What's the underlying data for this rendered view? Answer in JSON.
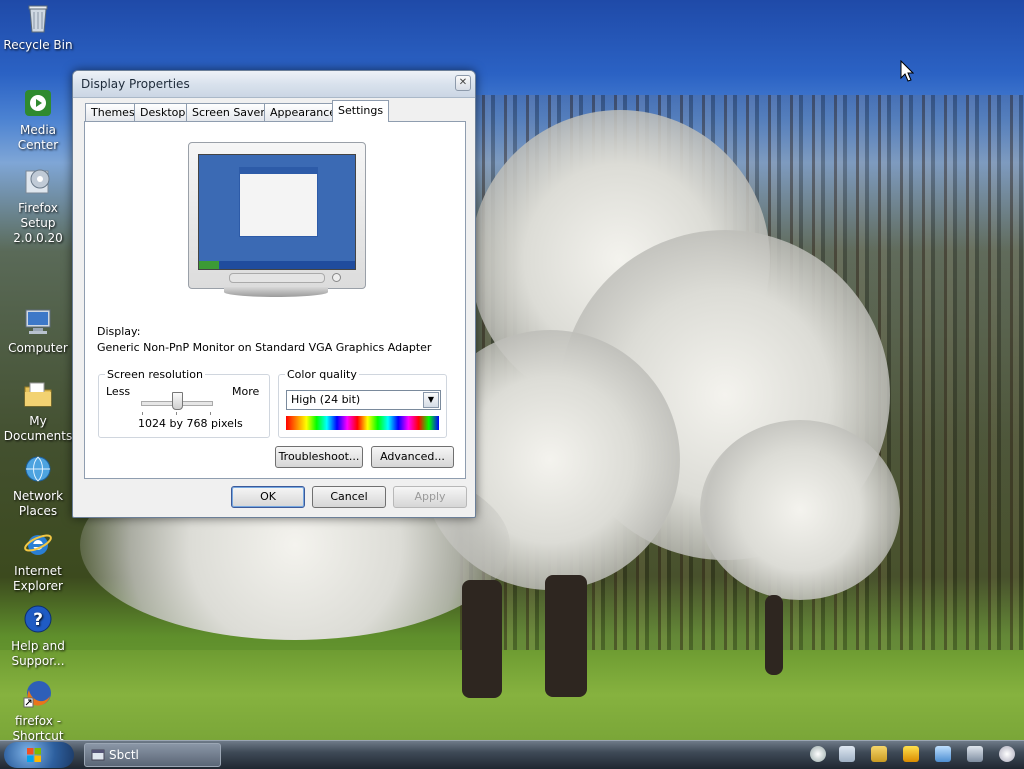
{
  "desktop": {
    "icons": [
      {
        "label": "Recycle Bin",
        "icon": "recycle-bin-icon"
      },
      {
        "label": "Media Center",
        "icon": "media-center-icon"
      },
      {
        "label": "Firefox Setup 2.0.0.20",
        "icon": "firefox-setup-icon"
      },
      {
        "label": "Computer",
        "icon": "computer-icon"
      },
      {
        "label": "My Documents",
        "icon": "my-documents-icon"
      },
      {
        "label": "Network Places",
        "icon": "network-places-icon"
      },
      {
        "label": "Internet Explorer",
        "icon": "internet-explorer-icon"
      },
      {
        "label": "Help and Suppor...",
        "icon": "help-support-icon"
      },
      {
        "label": "firefox - Shortcut",
        "icon": "firefox-shortcut-icon"
      }
    ]
  },
  "dialog": {
    "title": "Display Properties",
    "close_glyph": "✕",
    "tabs": [
      "Themes",
      "Desktop",
      "Screen Saver",
      "Appearance",
      "Settings"
    ],
    "active_tab": "Settings",
    "display_label": "Display:",
    "display_value": "Generic Non-PnP Monitor on Standard VGA Graphics Adapter",
    "resolution": {
      "group_title": "Screen resolution",
      "less_label": "Less",
      "more_label": "More",
      "value_text": "1024 by 768 pixels"
    },
    "color_quality": {
      "group_title": "Color quality",
      "selected": "High (24 bit)"
    },
    "buttons": {
      "troubleshoot": "Troubleshoot...",
      "advanced": "Advanced...",
      "ok": "OK",
      "cancel": "Cancel",
      "apply": "Apply"
    }
  },
  "taskbar": {
    "task_label": "Sbctl",
    "tray_icons": [
      "magnifier-icon",
      "bell-icon",
      "power-icon",
      "network-icon",
      "monitor-icon",
      "clock-icon"
    ]
  },
  "colors": {
    "taskbar": "#2b3440",
    "dialog_bg": "#f0f0f0",
    "accent": "#3c5a9a"
  }
}
